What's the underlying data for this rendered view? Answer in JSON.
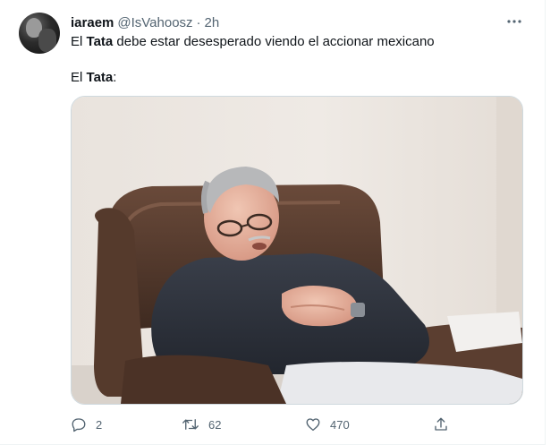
{
  "tweet": {
    "author_name": "iaraem",
    "author_handle": "@IsVahoosz",
    "separator": "·",
    "time": "2h",
    "text_line1_before": "El ",
    "text_line1_bold": "Tata",
    "text_line1_after": " debe estar desesperado viendo el accionar mexicano",
    "text_line2_before": "El ",
    "text_line2_bold": "Tata",
    "text_line2_after": ":"
  },
  "actions": {
    "reply_count": "2",
    "retweet_count": "62",
    "like_count": "470"
  },
  "icons": {
    "more": "more-horizontal-icon",
    "reply": "reply-icon",
    "retweet": "retweet-icon",
    "like": "heart-icon",
    "share": "share-icon"
  },
  "colors": {
    "text": "#0f1419",
    "secondary": "#536471",
    "border": "#cfd9de"
  }
}
